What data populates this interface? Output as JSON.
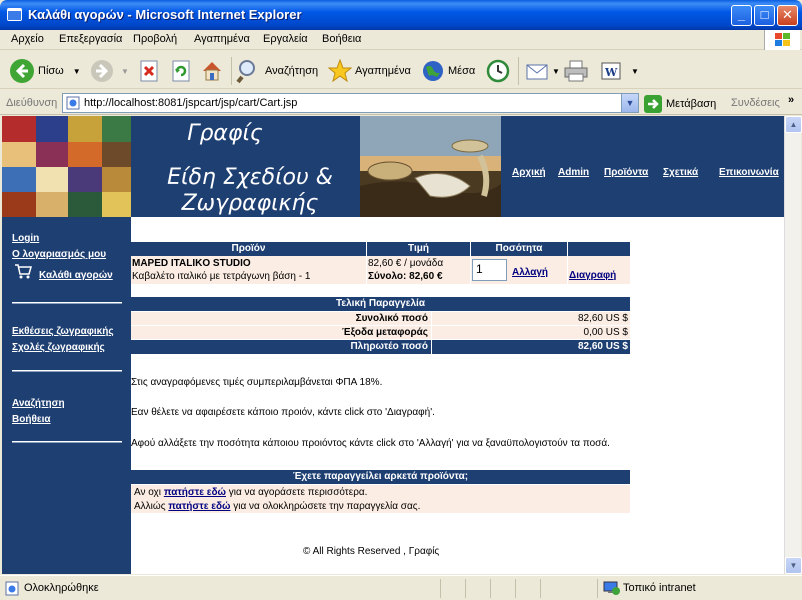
{
  "window": {
    "title": "Καλάθι αγορών - Microsoft Internet Explorer",
    "controls": {
      "minimize": "_",
      "maximize": "□",
      "close": "✕"
    }
  },
  "menu": [
    "Αρχείο",
    "Επεξεργασία",
    "Προβολή",
    "Αγαπημένα",
    "Εργαλεία",
    "Βοήθεια"
  ],
  "toolbar": {
    "back": "Πίσω",
    "search": "Αναζήτηση",
    "favorites": "Αγαπημένα",
    "media": "Μέσα"
  },
  "address": {
    "label": "Διεύθυνση",
    "url": "http://localhost:8081/jspcart/jsp/cart/Cart.jsp",
    "go": "Μετάβαση",
    "links": "Συνδέσεις",
    "more": "»"
  },
  "header": {
    "brand_line1": "Γραφίς",
    "brand_line2a": "Είδη Σχεδίου &",
    "brand_line2b": "Ζωγραφικής",
    "nav": [
      "Αρχική",
      "Admin",
      "Προϊόντα",
      "Σχετικά",
      "Επικοινωνία"
    ]
  },
  "sidebar": {
    "login": "Login",
    "account": "Ο λογαριασμός μου",
    "cart": "Καλάθι αγορών",
    "exhibitions": "Εκθέσεις ζωγραφικής",
    "schools": "Σχολές ζωγραφικής",
    "search": "Αναζήτηση",
    "help": "Βοήθεια"
  },
  "cart": {
    "headers": {
      "product": "Προϊόν",
      "price": "Τιμή",
      "quantity": "Ποσότητα"
    },
    "items": [
      {
        "brand": "MAPED ITALIKO STUDIO",
        "description": "Καβαλέτο ιταλικό με τετράγωνη βάση - 1",
        "unit_price": "82,60 € / μονάδα",
        "total": "Σύνολο: 82,60 €",
        "qty": "1",
        "update": "Αλλαγή",
        "delete": "Διαγραφή"
      }
    ]
  },
  "order": {
    "title": "Τελική Παραγγελία",
    "subtotal_label": "Συνολικό ποσό",
    "subtotal": "82,60 US $",
    "shipping_label": "Έξοδα μεταφοράς",
    "shipping": "0,00 US $",
    "payable_label": "Πληρωτέο ποσό",
    "payable": "82,60 US $"
  },
  "notes": [
    "Στις αναγραφόμενες τιμές συμπεριλαμβάνεται ΦΠΑ 18%.",
    "Εαν θέλετε να αφαιρέσετε κάποιο προιόν, κάντε click στο 'Διαγραφή'.",
    "Αφού αλλάξετε την ποσότητα κάποιου προιόντος κάντε click στο 'Αλλαγή' για να ξαναϋπολογιστούν τα ποσά."
  ],
  "enough": {
    "title": "Έχετε παραγγείλει αρκετά προϊόντα;",
    "line1_pre": "Αν οχι ",
    "line1_link": "πατήστε εδώ",
    "line1_post": " για να αγοράσετε περισσότερα.",
    "line2_pre": "Αλλιώς ",
    "line2_link": "πατήστε εδώ",
    "line2_post": " για να ολοκληρώσετε την παραγγελία σας."
  },
  "footer": "© All Rights Reserved , Γραφίς",
  "status": {
    "done": "Ολοκληρώθηκε",
    "zone": "Τοπικό intranet"
  }
}
